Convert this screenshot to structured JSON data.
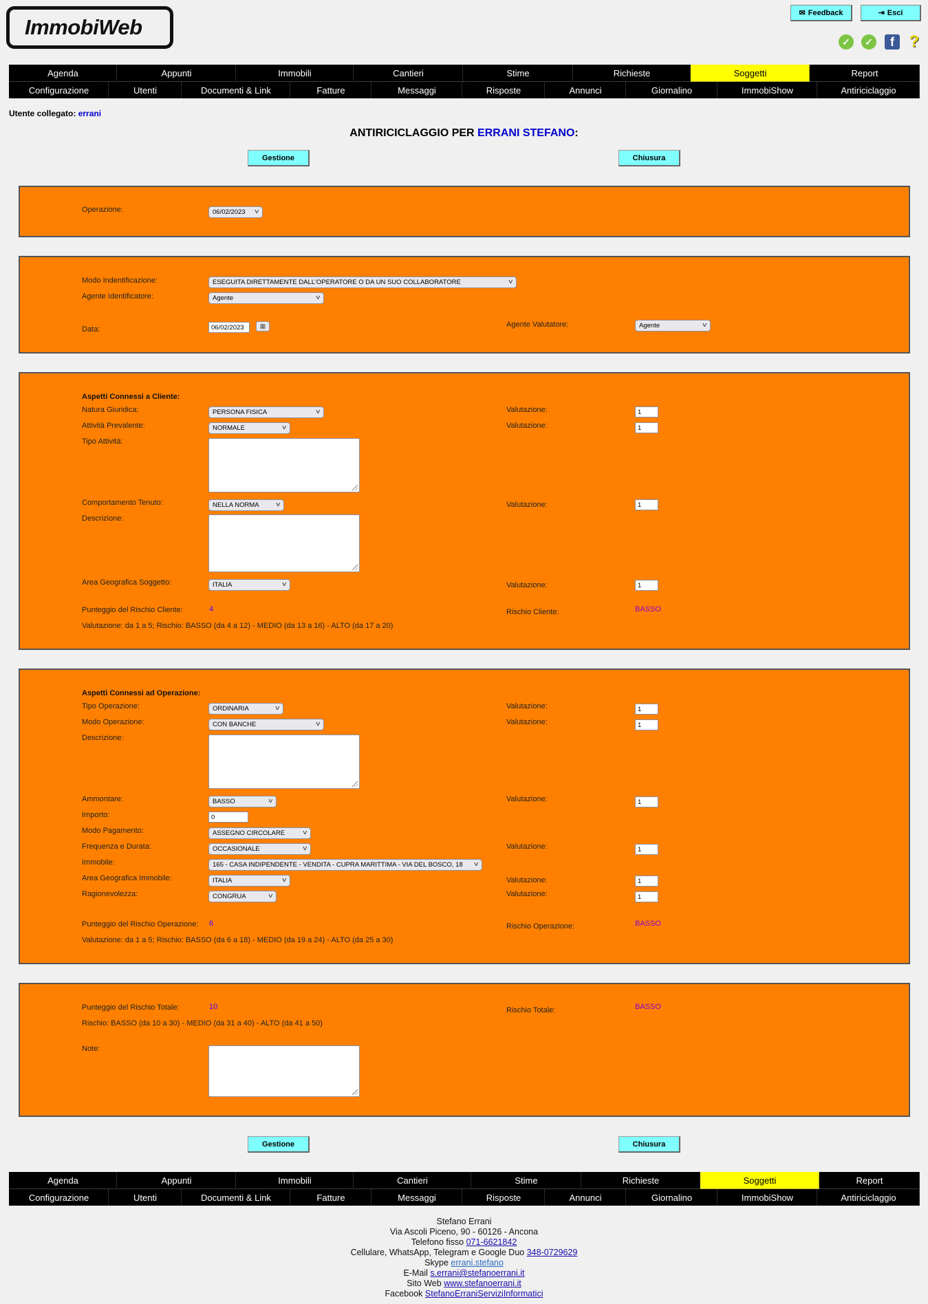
{
  "app": {
    "logo_text": "ImmobiWeb"
  },
  "header": {
    "feedback_label": "Feedback",
    "exit_label": "Esci",
    "icons": [
      "check-icon",
      "check-icon",
      "facebook-icon",
      "help-icon"
    ]
  },
  "nav": {
    "row1": [
      {
        "label": "Agenda"
      },
      {
        "label": "Appunti"
      },
      {
        "label": "Immobili"
      },
      {
        "label": "Cantieri"
      },
      {
        "label": "Stime"
      },
      {
        "label": "Richieste"
      },
      {
        "label": "Soggetti",
        "active": true
      },
      {
        "label": "Report"
      }
    ],
    "row2": [
      {
        "label": "Configurazione"
      },
      {
        "label": "Utenti"
      },
      {
        "label": "Documenti & Link"
      },
      {
        "label": "Fatture"
      },
      {
        "label": "Messaggi"
      },
      {
        "label": "Risposte"
      },
      {
        "label": "Annunci"
      },
      {
        "label": "Giornalino"
      },
      {
        "label": "ImmobiShow"
      },
      {
        "label": "Antiriciclaggio"
      }
    ]
  },
  "session": {
    "label": "Utente collegato:",
    "user": "errani"
  },
  "page": {
    "title_prefix": "ANTIRICICLAGGIO PER ",
    "title_name": "ERRANI STEFANO",
    "title_suffix": ":"
  },
  "actions": {
    "manage_label": "Gestione",
    "close_label": "Chiusura"
  },
  "operation_panel": {
    "label": "Operazione:",
    "value": "06/02/2023"
  },
  "identification_panel": {
    "mode_label": "Modo Indentificazione:",
    "mode_value": "ESEGUITA DIRETTAMENTE DALL'OPERATORE O DA UN SUO COLLABORATORE",
    "agent_id_label": "Agente Identificatore:",
    "agent_id_value": "Agente",
    "date_label": "Data:",
    "date_value": "06/02/2023",
    "agent_eval_label": "Agente Valutatore:",
    "agent_eval_value": "Agente"
  },
  "client_panel": {
    "heading": "Aspetti Connessi a Cliente:",
    "eval_label": "Valutazione:",
    "legal_nature_label": "Natura Giuridica:",
    "legal_nature_value": "PERSONA FISICA",
    "legal_nature_score": "1",
    "activity_label": "Attività Prevalente:",
    "activity_value": "NORMALE",
    "activity_score": "1",
    "activity_type_label": "Tipo Attività:",
    "activity_type_value": "",
    "behaviour_label": "Comportamento Tenuto:",
    "behaviour_value": "NELLA NORMA",
    "behaviour_score": "1",
    "description_label": "Descrizione:",
    "description_value": "",
    "area_label": "Area Geografica Soggetto:",
    "area_value": "ITALIA",
    "area_score": "1",
    "score_label": "Punteggio del Rischio Cliente:",
    "score_value": "4",
    "risk_label": "Rischio Cliente:",
    "risk_value": "BASSO",
    "legend": "Valutazione: da 1 a 5; Rischio: BASSO (da 4 a 12) - MEDIO (da 13 a 16) - ALTO (da 17 a 20)"
  },
  "operation_aspects_panel": {
    "heading": "Aspetti Connessi ad Operazione:",
    "eval_label": "Valutazione:",
    "type_label": "Tipo Operazione:",
    "type_value": "ORDINARIA",
    "type_score": "1",
    "mode_label": "Modo Operazione:",
    "mode_value": "CON BANCHE",
    "mode_score": "1",
    "description_label": "Descrizione:",
    "description_value": "",
    "amount_label": "Ammontare:",
    "amount_value": "BASSO",
    "amount_score": "1",
    "import_label": "Importo:",
    "import_value": "0",
    "payment_label": "Modo Pagamento:",
    "payment_value": "ASSEGNO CIRCOLARE",
    "frequency_label": "Frequenza e Durata:",
    "frequency_value": "OCCASIONALE",
    "frequency_score": "1",
    "property_label": "Immobile:",
    "property_value": "165 - CASA INDIPENDENTE - VENDITA - CUPRA MARITTIMA - VIA DEL BOSCO, 18",
    "property_area_label": "Area Geografica Immobile:",
    "property_area_value": "ITALIA",
    "property_area_score": "1",
    "reasonable_label": "Ragionevolezza:",
    "reasonable_value": "CONGRUA",
    "reasonable_score": "1",
    "score_label": "Punteggio del Rischio Operazione:",
    "score_value": "6",
    "risk_label": "Rischio Operazione:",
    "risk_value": "BASSO",
    "legend": "Valutazione: da 1 a 5; Rischio: BASSO (da 6 a 18) - MEDIO (da 19 a 24) - ALTO (da 25 a 30)"
  },
  "total_panel": {
    "score_label": "Punteggio del Rischio Totale:",
    "score_value": "10",
    "risk_label": "Rischio Totale:",
    "risk_value": "BASSO",
    "legend": "Rischio: BASSO (da 10 a 30) - MEDIO (da 31 a 40) - ALTO (da 41 a 50)",
    "notes_label": "Note:",
    "notes_value": ""
  },
  "footer": {
    "name": "Stefano Errani",
    "address": "Via Ascoli Piceno, 90 - 60126 - Ancona",
    "phone_label": "Telefono fisso",
    "phone": "071-6621842",
    "mobile_label": "Cellulare, WhatsApp, Telegram e Google Duo",
    "mobile": "348-0729629",
    "skype_label": "Skype",
    "skype": "errani.stefano",
    "email_label": "E-Mail",
    "email": "s.errani@stefanoerrani.it",
    "web_label": "Sito Web",
    "web": "www.stefanoerrani.it",
    "facebook_label": "Facebook",
    "facebook": "StefanoErraniServiziInformatici"
  }
}
